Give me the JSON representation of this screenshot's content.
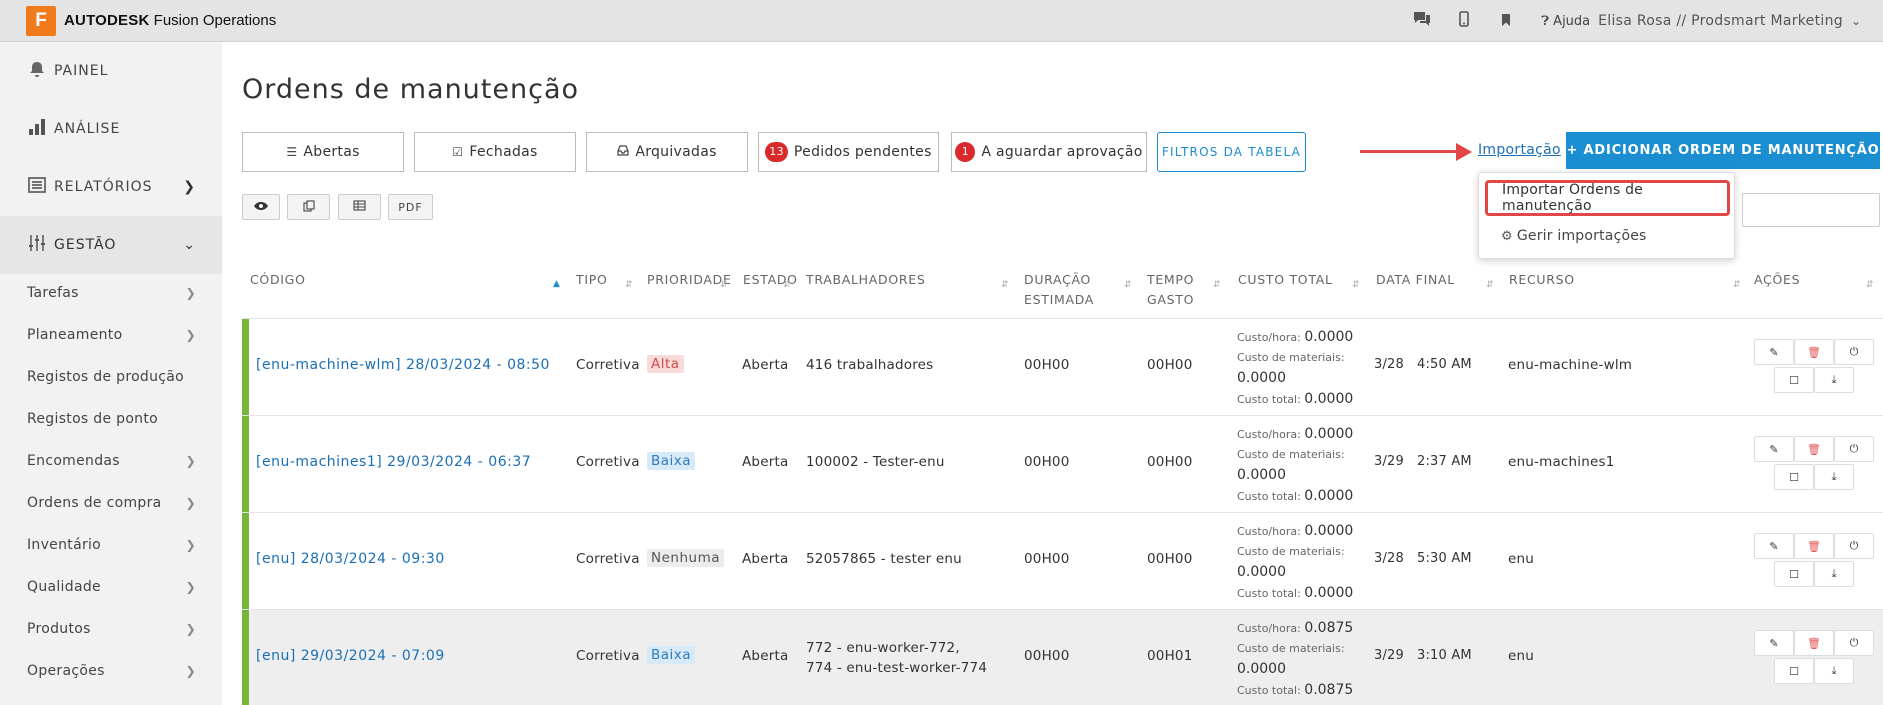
{
  "topbar": {
    "logo_letter": "F",
    "brand": "AUTODESK",
    "product": "Fusion Operations",
    "help": "Ajuda",
    "user": "Elisa Rosa // Prodsmart Marketing"
  },
  "sidebar": {
    "main": [
      {
        "label": "PAINEL",
        "icon": "bell-icon"
      },
      {
        "label": "ANÁLISE",
        "icon": "bar-chart-icon"
      },
      {
        "label": "RELATÓRIOS",
        "icon": "report-icon"
      },
      {
        "label": "GESTÃO",
        "icon": "sliders-icon"
      }
    ],
    "sub": [
      {
        "label": "Tarefas",
        "chevron": true
      },
      {
        "label": "Planeamento",
        "chevron": true
      },
      {
        "label": "Registos de produção",
        "chevron": false
      },
      {
        "label": "Registos de ponto",
        "chevron": false
      },
      {
        "label": "Encomendas",
        "chevron": true
      },
      {
        "label": "Ordens de compra",
        "chevron": true
      },
      {
        "label": "Inventário",
        "chevron": true
      },
      {
        "label": "Qualidade",
        "chevron": true
      },
      {
        "label": "Produtos",
        "chevron": true
      },
      {
        "label": "Operações",
        "chevron": true
      }
    ]
  },
  "page": {
    "title": "Ordens de manutenção",
    "tabs": {
      "open": "Abertas",
      "closed": "Fechadas",
      "archived": "Arquivadas",
      "pending": "Pedidos pendentes",
      "pending_count": "13",
      "awaiting": "A aguardar aprovação",
      "awaiting_count": "1"
    },
    "filters": "FILTROS DA TABELA",
    "import_link": "Importação",
    "add_button": "+ ADICIONAR ORDEM DE MANUTENÇÃO",
    "dropdown": {
      "import_orders": "Importar Ordens de manutenção",
      "manage_imports": "Gerir importações"
    },
    "toolbar": {
      "pdf": "PDF"
    }
  },
  "table": {
    "headers": {
      "code": "CÓDIGO",
      "type": "TIPO",
      "priority": "PRIORIDADE",
      "state": "ESTADO",
      "workers": "TRABALHADORES",
      "duration_1": "DURAÇÃO",
      "duration_2": "ESTIMADA",
      "time_1": "TEMPO",
      "time_2": "GASTO",
      "cost": "CUSTO TOTAL",
      "end_date": "DATA FINAL",
      "resource": "RECURSO",
      "actions": "AÇÕES"
    },
    "cost_labels": {
      "hour": "Custo/hora:",
      "materials": "Custo de materiais:",
      "total": "Custo total:"
    },
    "rows": [
      {
        "code": "[enu-machine-wlm] 28/03/2024 - 08:50",
        "type": "Corretiva",
        "priority": "Alta",
        "state": "Aberta",
        "workers_1": "416 trabalhadores",
        "workers_2": "",
        "duration": "00H00",
        "time": "00H00",
        "cost_hour": "0.0000",
        "cost_materials": "0.0000",
        "cost_total": "0.0000",
        "end_date": "3/28",
        "end_time": "4:50 AM",
        "resource": "enu-machine-wlm"
      },
      {
        "code": "[enu-machines1] 29/03/2024 - 06:37",
        "type": "Corretiva",
        "priority": "Baixa",
        "state": "Aberta",
        "workers_1": "100002 - Tester-enu",
        "workers_2": "",
        "duration": "00H00",
        "time": "00H00",
        "cost_hour": "0.0000",
        "cost_materials": "0.0000",
        "cost_total": "0.0000",
        "end_date": "3/29",
        "end_time": "2:37 AM",
        "resource": "enu-machines1"
      },
      {
        "code": "[enu] 28/03/2024 - 09:30",
        "type": "Corretiva",
        "priority": "Nenhuma",
        "state": "Aberta",
        "workers_1": "52057865 - tester enu",
        "workers_2": "",
        "duration": "00H00",
        "time": "00H00",
        "cost_hour": "0.0000",
        "cost_materials": "0.0000",
        "cost_total": "0.0000",
        "end_date": "3/28",
        "end_time": "5:30 AM",
        "resource": "enu"
      },
      {
        "code": "[enu] 29/03/2024 - 07:09",
        "type": "Corretiva",
        "priority": "Baixa",
        "state": "Aberta",
        "workers_1": "772 - enu-worker-772,",
        "workers_2": "774 - enu-test-worker-774",
        "duration": "00H00",
        "time": "00H01",
        "cost_hour": "0.0875",
        "cost_materials": "0.0000",
        "cost_total": "0.0875",
        "end_date": "3/29",
        "end_time": "3:10 AM",
        "resource": "enu"
      }
    ]
  },
  "colors": {
    "accent": "#1b8dd1",
    "logo": "#f07b1d",
    "status_bar": "#76b63c",
    "highlight": "#e04848"
  }
}
